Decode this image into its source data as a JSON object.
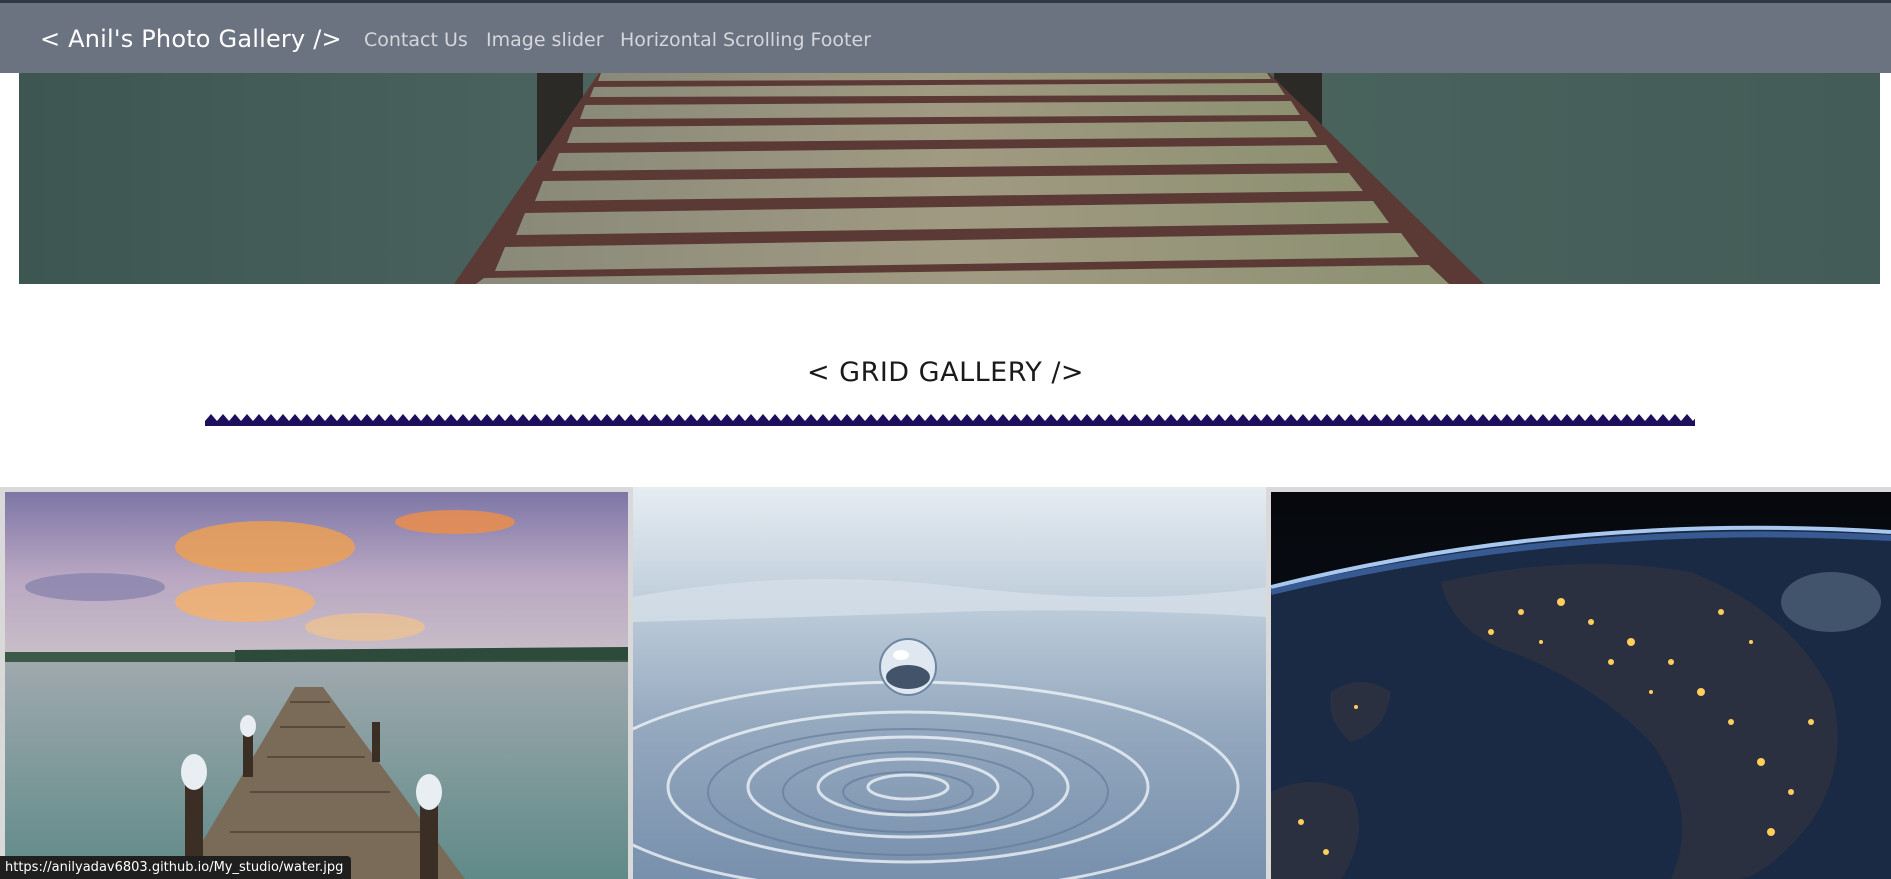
{
  "navbar": {
    "brand": "< Anil's Photo Gallery />",
    "links": [
      "Contact Us",
      "Image slider",
      "Horizontal Scrolling Footer"
    ]
  },
  "hero": {
    "subject": "wooden pier over calm water"
  },
  "gallery": {
    "title": "< GRID GALLERY />",
    "accent_color": "#1e0f5c",
    "tiles": [
      {
        "subject": "pier at sunset"
      },
      {
        "subject": "water droplet ripple"
      },
      {
        "subject": "earth at night from space"
      }
    ]
  },
  "status_bar": {
    "url": "https://anilyadav6803.github.io/My_studio/water.jpg"
  },
  "colors": {
    "navbar_bg": "#6b7280",
    "brand_text": "#ffffff",
    "nav_link_text": "#d4d7dc"
  }
}
